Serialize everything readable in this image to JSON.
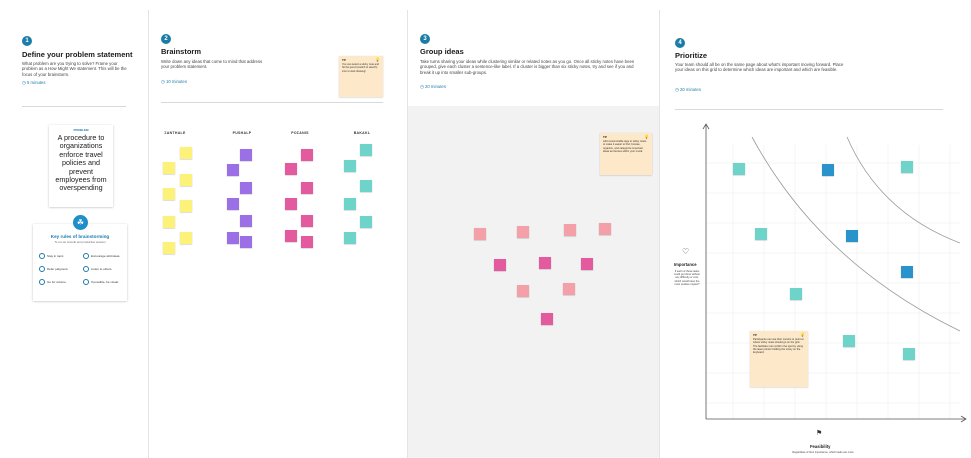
{
  "step1": {
    "number": "1",
    "title": "Define your problem statement",
    "description": "What problem are you trying to solve? Frame your problem as a How Might We statement. This will be the focus of your brainstorm.",
    "time": "5 minutes",
    "card_label": "PROBLEM",
    "card_text": "A procedure to organizations enforce travel policies and prevent employees from overspending",
    "rules_title": "Key rules of brainstorming",
    "rules_subtitle": "To run an smooth and productive session",
    "rules": [
      "Stay in topic.",
      "Encourage wild ideas.",
      "Defer judgment.",
      "Listen to others.",
      "Go for volume.",
      "If possible, be visual."
    ]
  },
  "step2": {
    "number": "2",
    "title": "Brainstorm",
    "description": "Write down any ideas that come to mind that address your problem statement.",
    "time": "10 minutes",
    "tip_label": "TIP",
    "tip_text": "You can select a sticky note and hit the pencil (switch to sketch) icon to start drawing!",
    "columns": [
      "ΣANTHALE",
      "PUSHALP",
      "ΡΟΣΑΝΙS",
      "ΒΑΚΑΚL"
    ]
  },
  "step3": {
    "number": "3",
    "title": "Group ideas",
    "description": "Take turns sharing your ideas while clustering similar or related notes as you go. Once all sticky notes have been grouped, give each cluster a sentence-like label. If a cluster is bigger than six sticky notes, try and see if you and break it up into smaller sub-groups.",
    "time": "20 minutes",
    "tip_label": "TIP",
    "tip_text": "Add customizable tags to sticky notes to make it easier to find, browse, organize, and categorize important ideas as themes within your mural."
  },
  "step4": {
    "number": "4",
    "title": "Prioritize",
    "description": "Your team should all be on the same page about what's important moving forward. Place your ideas on this grid to determine which ideas are important and which are feasible.",
    "time": "20 minutes",
    "y_axis_label": "Importance",
    "y_axis_desc": "If each of these tasks could get done without any difficulty or cost, which would have the most positive impact?",
    "x_axis_label": "Feasibility",
    "x_axis_desc": "Regardless of their importance, which tasks are more",
    "tip_label": "TIP",
    "tip_text": "Participants can use their cursors to point at where sticky notes should go on the grid. The facilitator can confirm the spot by using the laser pointer holding the H key on the keyboard."
  },
  "colors": {
    "accent": "#1b7ca8",
    "yellow": "#fcf27a",
    "violet": "#9b6fe6",
    "magenta": "#e35b9e",
    "teal": "#6ed3c8",
    "pink": "#f4a0a8",
    "blue": "#2b93cc",
    "tip": "#fde8c9"
  }
}
